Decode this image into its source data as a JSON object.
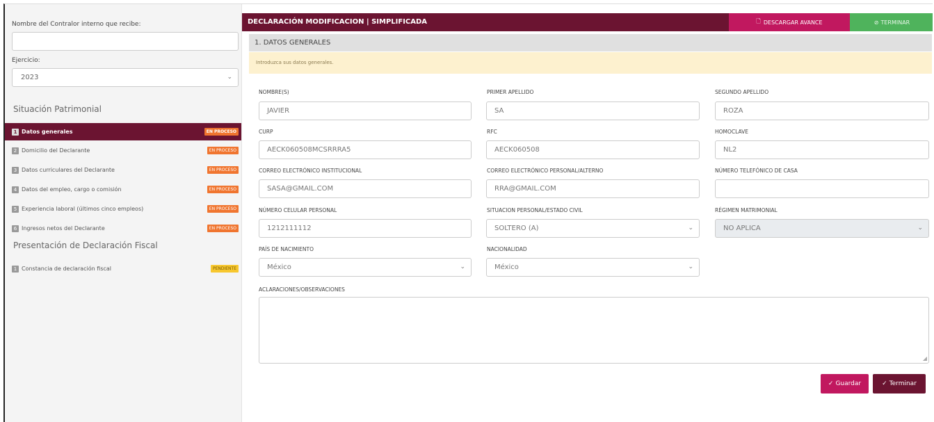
{
  "sidebar": {
    "receiver_label": "Nombre del Contralor interno que recibe:",
    "receiver_value": "",
    "year_label": "Ejercicio:",
    "year_value": "2023",
    "section1_title": "Situación Patrimonial",
    "items": [
      {
        "num": "1",
        "label": "Datos generales",
        "badge": "EN PROCESO"
      },
      {
        "num": "2",
        "label": "Domicilio del Declarante",
        "badge": "EN PROCESO"
      },
      {
        "num": "3",
        "label": "Datos curriculares del Declarante",
        "badge": "EN PROCESO"
      },
      {
        "num": "4",
        "label": "Datos del empleo, cargo o comisión",
        "badge": "EN PROCESO"
      },
      {
        "num": "5",
        "label": "Experiencia laboral (últimos cinco empleos)",
        "badge": "EN PROCESO"
      },
      {
        "num": "6",
        "label": "Ingresos netos del Declarante",
        "badge": "EN PROCESO"
      }
    ],
    "section2_title": "Presentación de Declaración Fiscal",
    "fiscal_items": [
      {
        "num": "1",
        "label": "Constancia de declaración fiscal",
        "badge": "PENDIENTE"
      }
    ]
  },
  "header": {
    "title": "DECLARACIÓN MODIFICACION | SIMPLIFICADA",
    "download_label": "DESCARGAR AVANCE",
    "finish_label": "TERMINAR"
  },
  "section": {
    "title": "1. DATOS GENERALES",
    "notice": "Introduzca sus datos generales."
  },
  "form": {
    "nombre": {
      "label": "NOMBRE(S)",
      "value": "JAVIER"
    },
    "primer_apellido": {
      "label": "PRIMER APELLIDO",
      "value": "SA"
    },
    "segundo_apellido": {
      "label": "SEGUNDO APELLIDO",
      "value": "ROZA"
    },
    "curp": {
      "label": "CURP",
      "value": "AECK060508MCSRRRA5"
    },
    "rfc": {
      "label": "RFC",
      "value": "AECK060508"
    },
    "homoclave": {
      "label": "HOMOCLAVE",
      "value": "NL2"
    },
    "correo_inst": {
      "label": "CORREO ELECTRÓNICO INSTITUCIONAL",
      "value": "SASA@GMAIL.COM"
    },
    "correo_personal": {
      "label": "CORREO ELECTRÓNICO PERSONAL/ALTERNO",
      "value": "RRA@GMAIL.COM"
    },
    "tel_casa": {
      "label": "NÚMERO TELEFÓNICO DE CASA",
      "value": ""
    },
    "celular": {
      "label": "NÚMERO CELULAR PERSONAL",
      "value": "1212111112"
    },
    "estado_civil": {
      "label": "SITUACION PERSONAL/ESTADO CIVIL",
      "value": "SOLTERO (A)"
    },
    "regimen": {
      "label": "RÉGIMEN MATRIMONIAL",
      "value": "NO APLICA"
    },
    "pais": {
      "label": "PAÍS DE NACIMIENTO",
      "value": "México"
    },
    "nacionalidad": {
      "label": "NACIONALIDAD",
      "value": "México"
    },
    "aclaraciones": {
      "label": "ACLARACIONES/OBSERVACIONES",
      "value": ""
    }
  },
  "actions": {
    "save_label": "Guardar",
    "finish_label": "Terminar"
  },
  "colors": {
    "primary": "#6b1431",
    "accent": "#c1185f",
    "success": "#4fb35c",
    "badge_in_progress": "#f0752f",
    "badge_pending": "#f7c72e"
  }
}
